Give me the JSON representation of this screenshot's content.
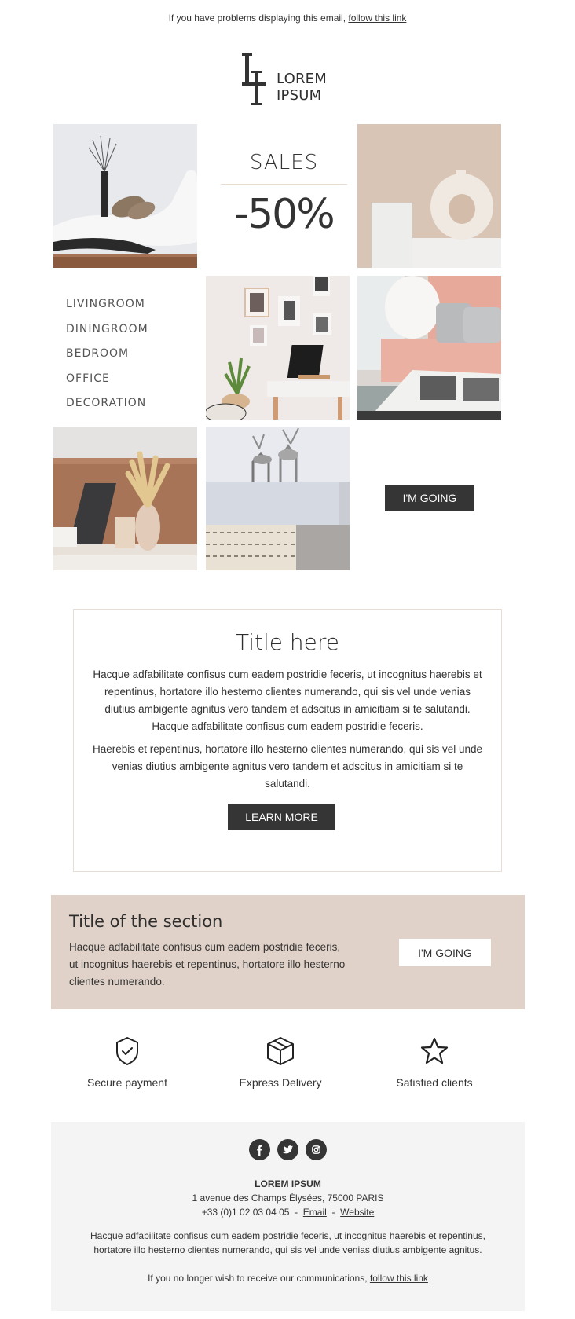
{
  "preheader": {
    "text": "If you have problems displaying this email, ",
    "link": "follow this link"
  },
  "logo": {
    "monogram": "LI",
    "line1": "LOREM",
    "line2": "IPSUM"
  },
  "hero": {
    "sales_label": "SALES",
    "discount": "-50%"
  },
  "categories": [
    "LIVINGROOM",
    "DININGROOM",
    "BEDROOM",
    "OFFICE",
    "DECORATION"
  ],
  "gallery_cta": "I'M GOING",
  "info_box": {
    "title": "Title here",
    "paragraph1": "Hacque adfabilitate confisus cum eadem postridie feceris, ut incognitus haerebis et repentinus, hortatore illo hesterno clientes numerando, qui sis vel unde venias diutius ambigente agnitus vero tandem et adscitus in amicitiam si te salutandi. Hacque adfabilitate confisus cum eadem postridie feceris.",
    "paragraph2": "Haerebis et repentinus, hortatore illo hesterno clientes numerando, qui sis vel unde venias diutius ambigente agnitus vero tandem et adscitus in amicitiam si te salutandi.",
    "button": "LEARN MORE"
  },
  "section": {
    "title": "Title of the section",
    "text": "Hacque adfabilitate confisus cum eadem postridie feceris, ut incognitus haerebis et repentinus, hortatore illo hesterno clientes numerando.",
    "button": "I'M GOING",
    "bg_color": "#e0d2c8"
  },
  "features": [
    {
      "icon": "shield-check-icon",
      "label": "Secure payment"
    },
    {
      "icon": "box-icon",
      "label": "Express Delivery"
    },
    {
      "icon": "star-icon",
      "label": "Satisfied clients"
    }
  ],
  "footer": {
    "socials": [
      "facebook-icon",
      "twitter-icon",
      "instagram-icon"
    ],
    "brand": "LOREM IPSUM",
    "address": "1 avenue des Champs Élysées, 75000 PARIS",
    "phone": "+33 (0)1 02 03 04 05",
    "separator": "-",
    "email_link": "Email",
    "website_link": "Website",
    "description": "Hacque adfabilitate confisus cum eadem postridie feceris, ut incognitus haerebis et repentinus, hortatore illo hesterno clientes numerando, qui sis vel unde venias diutius ambigente agnitus.",
    "unsubscribe_text": "If you no longer wish to receive our communications, ",
    "unsubscribe_link": "follow this link"
  },
  "colors": {
    "dark_button": "#353535",
    "section_bg": "#e0d2c8",
    "footer_bg": "#f4f4f4",
    "text": "#333333"
  }
}
